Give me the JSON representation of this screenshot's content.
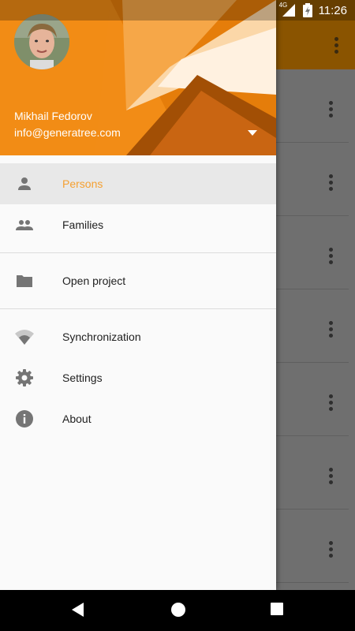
{
  "status_bar": {
    "network": "4G",
    "time": "11:26"
  },
  "drawer": {
    "user": {
      "name": "Mikhail Fedorov",
      "email": "info@generatree.com"
    },
    "items": [
      {
        "label": "Persons",
        "icon": "person-icon",
        "selected": true
      },
      {
        "label": "Families",
        "icon": "people-icon"
      },
      {
        "label": "Open project",
        "icon": "folder-icon"
      },
      {
        "label": "Synchronization",
        "icon": "wifi-icon"
      },
      {
        "label": "Settings",
        "icon": "gear-icon"
      },
      {
        "label": "About",
        "icon": "info-icon"
      }
    ]
  },
  "colors": {
    "accent": "#f5a031",
    "header": "#f08a14",
    "toolbar_dim": "#8a5400"
  }
}
